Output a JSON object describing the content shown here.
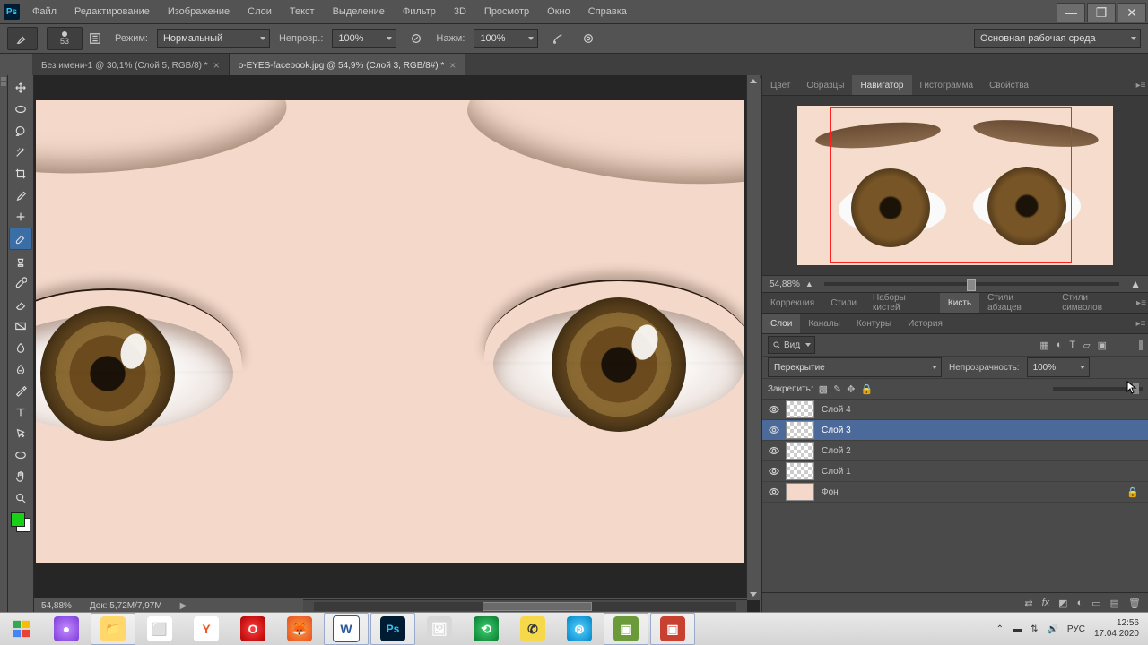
{
  "menubar": {
    "items": [
      "Файл",
      "Редактирование",
      "Изображение",
      "Слои",
      "Текст",
      "Выделение",
      "Фильтр",
      "3D",
      "Просмотр",
      "Окно",
      "Справка"
    ],
    "logo_text": "Ps"
  },
  "options": {
    "brush_size": "53",
    "mode_label": "Режим:",
    "mode_value": "Нормальный",
    "opacity_label": "Непрозр.:",
    "opacity_value": "100%",
    "flow_label": "Нажм:",
    "flow_value": "100%",
    "workspace": "Основная рабочая среда"
  },
  "tabs": [
    {
      "label": "Без имени-1 @ 30,1% (Слой 5, RGB/8) *",
      "active": false
    },
    {
      "label": "o-EYES-facebook.jpg @ 54,9% (Слой 3, RGB/8#) *",
      "active": true
    }
  ],
  "canvas": {
    "zoom": "54,88%",
    "docsize": "Док: 5,72M/7,97M"
  },
  "panels": {
    "group1": [
      "Цвет",
      "Образцы",
      "Навигатор",
      "Гистограмма",
      "Свойства"
    ],
    "group1_active": 2,
    "nav_zoom": "54,88%",
    "group2": [
      "Коррекция",
      "Стили",
      "Наборы кистей",
      "Кисть",
      "Стили абзацев",
      "Стили символов"
    ],
    "group2_active": 3,
    "group3": [
      "Слои",
      "Каналы",
      "Контуры",
      "История"
    ],
    "group3_active": 0
  },
  "layers": {
    "filter_label": "Вид",
    "blend_mode": "Перекрытие",
    "opacity_label": "Непрозрачность:",
    "opacity_value": "100%",
    "lock_label": "Закрепить:",
    "items": [
      {
        "name": "Слой 4",
        "selected": false,
        "thumb": "checker"
      },
      {
        "name": "Слой 3",
        "selected": true,
        "thumb": "checker"
      },
      {
        "name": "Слой 2",
        "selected": false,
        "thumb": "checker"
      },
      {
        "name": "Слой 1",
        "selected": false,
        "thumb": "checker"
      },
      {
        "name": "Фон",
        "selected": false,
        "thumb": "img",
        "locked": true
      }
    ]
  },
  "taskbar": {
    "tray_lang": "РУС",
    "time": "12:56",
    "date": "17.04.2020"
  }
}
